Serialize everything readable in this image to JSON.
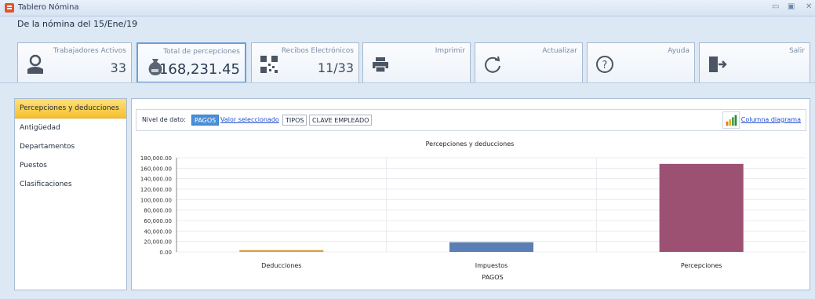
{
  "window": {
    "title": "Tablero Nómina",
    "controls": [
      "▭",
      "▣",
      "✕"
    ]
  },
  "period_label": "De la nómina del 15/Ene/19",
  "tiles": [
    {
      "label": "Trabajadores Activos",
      "value": "33",
      "icon": "worker-icon"
    },
    {
      "label": "Total de percepciones",
      "value": "168,231.45",
      "icon": "money-bag-icon"
    },
    {
      "label": "Recibos Electrónicos",
      "value": "11/33",
      "icon": "qr-code-icon"
    },
    {
      "label": "Imprimir",
      "icon": "printer-icon"
    },
    {
      "label": "Actualizar",
      "icon": "refresh-icon"
    },
    {
      "label": "Ayuda",
      "icon": "help-icon"
    },
    {
      "label": "Salir",
      "icon": "exit-icon"
    }
  ],
  "sidebar": {
    "items": [
      {
        "label": "Percepciones y deducciones",
        "active": true
      },
      {
        "label": "Antigüedad",
        "active": false
      },
      {
        "label": "Departamentos",
        "active": false
      },
      {
        "label": "Puestos",
        "active": false
      },
      {
        "label": "Clasificaciones",
        "active": false
      }
    ]
  },
  "toolbar": {
    "level_label": "Nivel de dato:",
    "chips": [
      "PAGOS",
      "Valor seleccionado",
      "TIPOS",
      "CLAVE EMPLEADO"
    ],
    "column_diagram": "Columna diagrama"
  },
  "colors": {
    "accent": "#4a90d9",
    "active_nav": "#f6c030"
  },
  "chart_data": {
    "type": "bar",
    "title": "Percepciones y deducciones",
    "xlabel": "PAGOS",
    "ylabel": "",
    "ylim": [
      0,
      180000
    ],
    "y_ticks": [
      "180,000.00",
      "160,000.00",
      "140,000.00",
      "120,000.00",
      "100,000.00",
      "80,000.00",
      "60,000.00",
      "40,000.00",
      "20,000.00",
      "0.00"
    ],
    "categories": [
      "Deducciones",
      "Impuestos",
      "Percepciones"
    ],
    "values": [
      3500,
      18500,
      168231.45
    ],
    "colors": [
      "#d9a13b",
      "#5b7fb4",
      "#9c5173"
    ],
    "grid": true
  }
}
